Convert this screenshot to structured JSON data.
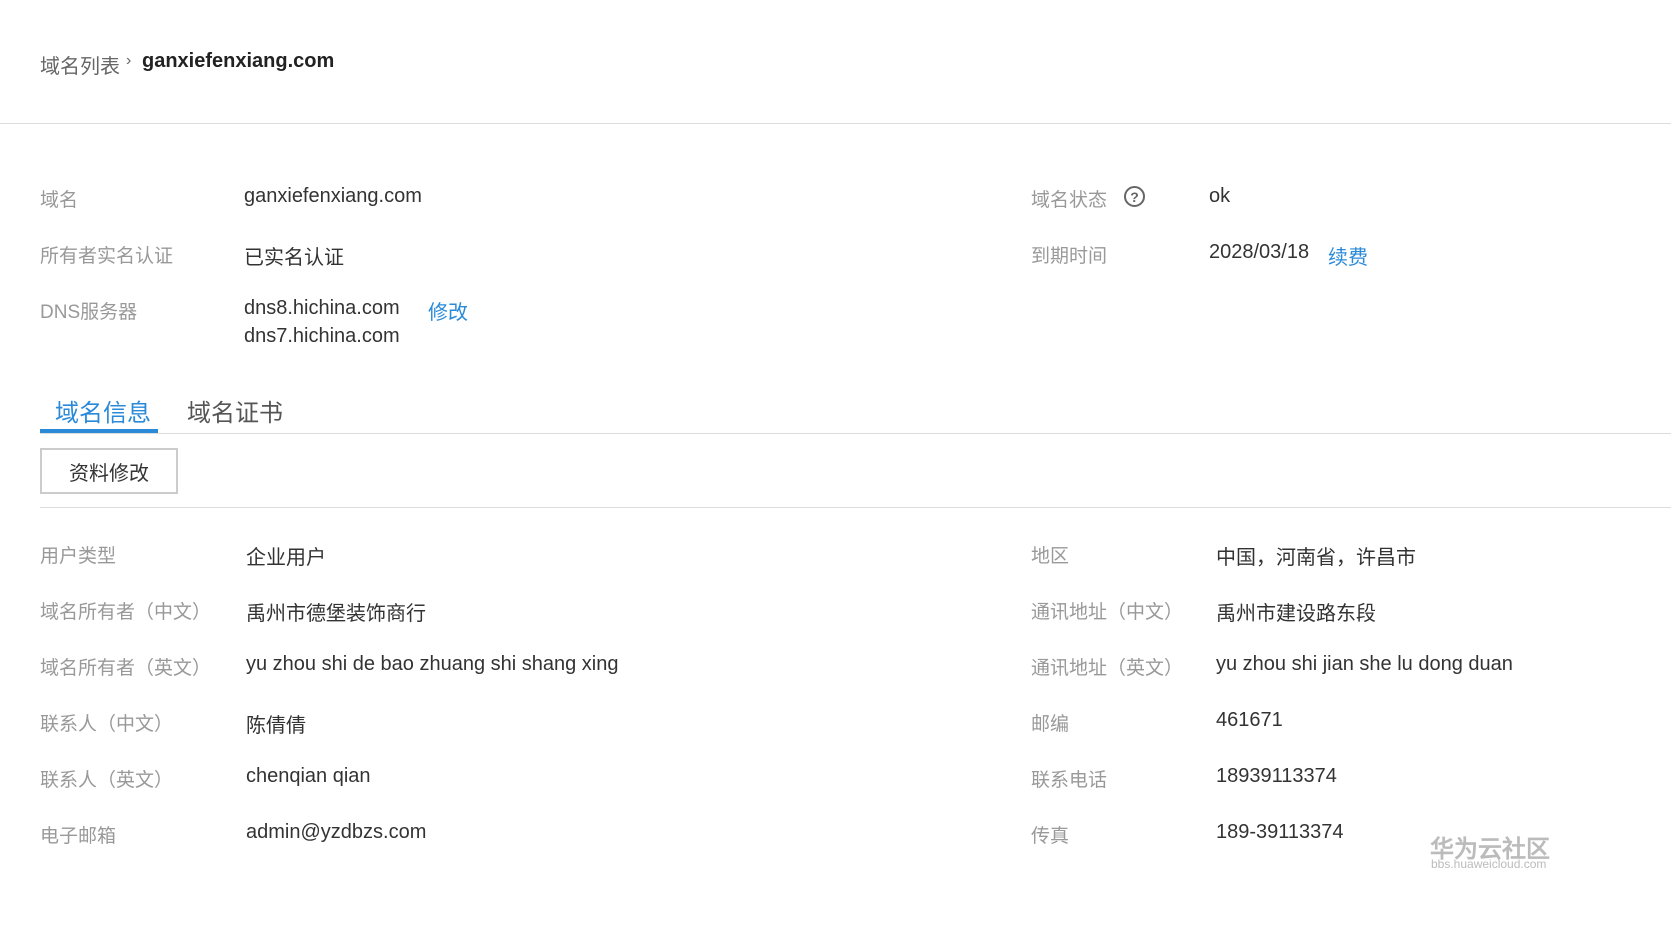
{
  "breadcrumb": {
    "parent": "域名列表",
    "separator": "›",
    "current": "ganxiefenxiang.com"
  },
  "summary": {
    "domain_label": "域名",
    "domain_value": "ganxiefenxiang.com",
    "status_label": "域名状态",
    "status_value": "ok",
    "owner_auth_label": "所有者实名认证",
    "owner_auth_value": "已实名认证",
    "expire_label": "到期时间",
    "expire_value": "2028/03/18",
    "renew_link": "续费",
    "dns_label": "DNS服务器",
    "dns_servers": [
      "dns8.hichina.com",
      "dns7.hichina.com"
    ],
    "dns_modify_link": "修改"
  },
  "tabs": [
    {
      "label": "域名信息",
      "active": true
    },
    {
      "label": "域名证书",
      "active": false
    }
  ],
  "edit_button": "资料修改",
  "info": {
    "left": [
      {
        "label": "用户类型",
        "value": "企业用户"
      },
      {
        "label": "域名所有者（中文）",
        "value": "禹州市德堡装饰商行"
      },
      {
        "label": "域名所有者（英文）",
        "value": "yu zhou shi de bao zhuang shi shang xing"
      },
      {
        "label": "联系人（中文）",
        "value": "陈倩倩"
      },
      {
        "label": "联系人（英文）",
        "value": "chenqian qian"
      },
      {
        "label": "电子邮箱",
        "value": "admin@yzdbzs.com"
      }
    ],
    "right": [
      {
        "label": "地区",
        "value": "中国，河南省，许昌市"
      },
      {
        "label": "通讯地址（中文）",
        "value": "禹州市建设路东段"
      },
      {
        "label": "通讯地址（英文）",
        "value": "yu zhou shi jian she lu dong duan"
      },
      {
        "label": "邮编",
        "value": "461671"
      },
      {
        "label": "联系电话",
        "value": "18939113374"
      },
      {
        "label": "传真",
        "value": "189-39113374"
      }
    ]
  },
  "watermark": {
    "title": "华为云社区",
    "url": "bbs.huaweicloud.com"
  },
  "colors": {
    "accent": "#2b8ad8",
    "label": "#999999",
    "text": "#333333"
  },
  "icons": {
    "help": "question-circle-icon"
  }
}
